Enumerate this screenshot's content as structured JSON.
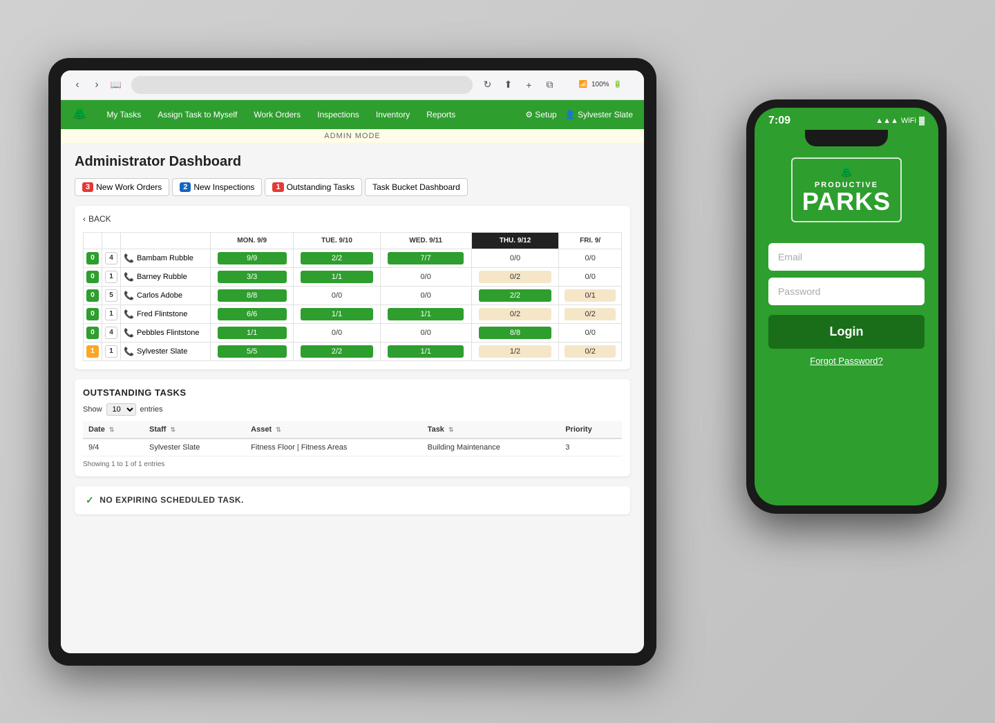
{
  "tablet": {
    "browser": {
      "back_btn": "‹",
      "forward_btn": "›",
      "book_icon": "📖",
      "refresh_icon": "↻",
      "share_icon": "⬆",
      "add_icon": "+",
      "tabs_icon": "⧉",
      "battery": "100%",
      "wifi": "WiFi"
    },
    "nav": {
      "logo": "🌲",
      "items": [
        "My Tasks",
        "Assign Task to Myself",
        "Work Orders",
        "Inspections",
        "Inventory",
        "Reports"
      ],
      "setup": "⚙ Setup",
      "user": "Sylvester Slate"
    },
    "admin_banner": "ADMIN MODE",
    "page_title": "Administrator Dashboard",
    "tabs": [
      {
        "badge": "3",
        "badge_color": "red",
        "label": "New Work Orders"
      },
      {
        "badge": "2",
        "badge_color": "blue",
        "label": "New Inspections"
      },
      {
        "badge": "1",
        "badge_color": "red",
        "label": "Outstanding Tasks"
      },
      {
        "label": "Task Bucket Dashboard"
      }
    ],
    "back_label": "BACK",
    "schedule": {
      "columns": [
        "",
        "",
        "",
        "",
        "MON. 9/9",
        "TUE. 9/10",
        "WED. 9/11",
        "THU. 9/12",
        "FRI. 9/"
      ],
      "rows": [
        {
          "n1": "0",
          "n1_color": "green",
          "n2": "4",
          "n2_color": "white",
          "name": "Bambam Rubble",
          "mon": "9/9",
          "mon_color": "green",
          "tue": "2/2",
          "tue_color": "green",
          "wed": "7/7",
          "wed_color": "green",
          "thu": "0/0",
          "thu_color": "plain",
          "fri": "0/0",
          "fri_color": "plain"
        },
        {
          "n1": "0",
          "n1_color": "green",
          "n2": "1",
          "n2_color": "white",
          "name": "Barney Rubble",
          "mon": "3/3",
          "mon_color": "green",
          "tue": "1/1",
          "tue_color": "green",
          "wed": "0/0",
          "wed_color": "plain",
          "thu": "0/2",
          "thu_color": "tan",
          "fri": "0/0",
          "fri_color": "plain"
        },
        {
          "n1": "0",
          "n1_color": "green",
          "n2": "5",
          "n2_color": "white",
          "name": "Carlos Adobe",
          "mon": "8/8",
          "mon_color": "green",
          "tue": "0/0",
          "tue_color": "plain",
          "wed": "0/0",
          "wed_color": "plain",
          "thu": "2/2",
          "thu_color": "green",
          "fri": "0/1",
          "fri_color": "tan"
        },
        {
          "n1": "0",
          "n1_color": "green",
          "n2": "1",
          "n2_color": "white",
          "name": "Fred Flintstone",
          "mon": "6/6",
          "mon_color": "green",
          "tue": "1/1",
          "tue_color": "green",
          "wed": "1/1",
          "wed_color": "green",
          "thu": "0/2",
          "thu_color": "tan",
          "fri": "0/2",
          "fri_color": "tan"
        },
        {
          "n1": "0",
          "n1_color": "green",
          "n2": "4",
          "n2_color": "white",
          "name": "Pebbles Flintstone",
          "mon": "1/1",
          "mon_color": "green",
          "tue": "0/0",
          "tue_color": "plain",
          "wed": "0/0",
          "wed_color": "plain",
          "thu": "8/8",
          "thu_color": "green",
          "fri": "0/0",
          "fri_color": "plain"
        },
        {
          "n1": "1",
          "n1_color": "yellow",
          "n2": "1",
          "n2_color": "white",
          "name": "Sylvester Slate",
          "mon": "5/5",
          "mon_color": "green",
          "tue": "2/2",
          "tue_color": "green",
          "wed": "1/1",
          "wed_color": "green",
          "thu": "1/2",
          "thu_color": "tan",
          "fri": "0/2",
          "fri_color": "tan"
        }
      ]
    },
    "outstanding_tasks": {
      "title": "OUTSTANDING TASKS",
      "show_label": "Show",
      "entries_label": "entries",
      "show_value": "10",
      "columns": [
        "Date",
        "Staff",
        "Asset",
        "Task",
        "Priority"
      ],
      "rows": [
        {
          "date": "9/4",
          "staff": "Sylvester Slate",
          "asset": "Fitness Floor | Fitness Areas",
          "task": "Building Maintenance",
          "priority": "3"
        }
      ],
      "footer": "Showing 1 to 1 of 1 entries"
    },
    "no_expiring": "NO EXPIRING SCHEDULED TASK."
  },
  "phone": {
    "time": "7:09",
    "logo_icon": "🌲",
    "logo_sub": "PRODUCTIVE",
    "logo_main": "PARKS",
    "email_placeholder": "Email",
    "password_placeholder": "Password",
    "login_btn": "Login",
    "forgot_password": "Forgot Password?"
  }
}
